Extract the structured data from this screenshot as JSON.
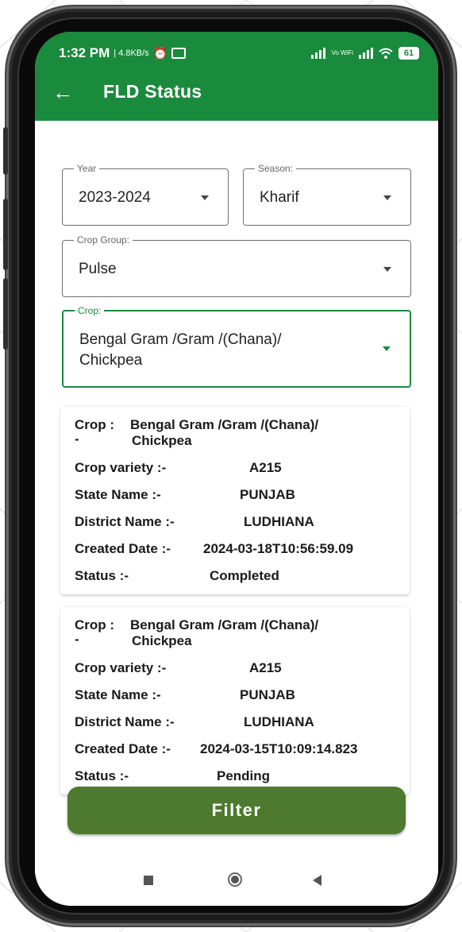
{
  "status_bar": {
    "time": "1:32 PM",
    "speed": "4.8KB/s",
    "alarm_icon": "alarm-clock-icon",
    "message_icon": "message-icon",
    "volte": "Vo WiFi",
    "battery": "61"
  },
  "app_bar": {
    "back_icon": "arrow-left-icon",
    "title": "FLD Status"
  },
  "filters": {
    "year": {
      "label": "Year",
      "value": "2023-2024"
    },
    "season": {
      "label": "Season:",
      "value": "Kharif"
    },
    "crop_group": {
      "label": "Crop Group:",
      "value": "Pulse"
    },
    "crop": {
      "label": "Crop:",
      "value_line1": "Bengal Gram /Gram /(Chana)/",
      "value_line2": "Chickpea"
    }
  },
  "records": [
    {
      "crop_label": "Crop :",
      "crop_dash": "-",
      "crop_line1": "Bengal Gram /Gram /(Chana)/",
      "crop_line2": "Chickpea",
      "variety_label": "Crop variety :-",
      "variety": "A215",
      "state_label": "State Name :-",
      "state": "PUNJAB",
      "district_label": "District Name :-",
      "district": "LUDHIANA",
      "created_label": "Created Date :-",
      "created": "2024-03-18T10:56:59.09",
      "status_label": "Status :-",
      "status": "Completed"
    },
    {
      "crop_label": "Crop :",
      "crop_dash": "-",
      "crop_line1": "Bengal Gram /Gram /(Chana)/",
      "crop_line2": "Chickpea",
      "variety_label": "Crop variety :-",
      "variety": "A215",
      "state_label": "State Name :-",
      "state": "PUNJAB",
      "district_label": "District Name :-",
      "district": "LUDHIANA",
      "created_label": "Created Date :-",
      "created": "2024-03-15T10:09:14.823",
      "status_label": "Status :-",
      "status": "Pending"
    }
  ],
  "filter_button": "Filter",
  "nav": {
    "recents_icon": "square-icon",
    "home_icon": "circle-icon",
    "back_icon": "triangle-back-icon"
  },
  "colors": {
    "primary_green": "#1a8a3c",
    "filter_green": "#4d7a2f"
  }
}
